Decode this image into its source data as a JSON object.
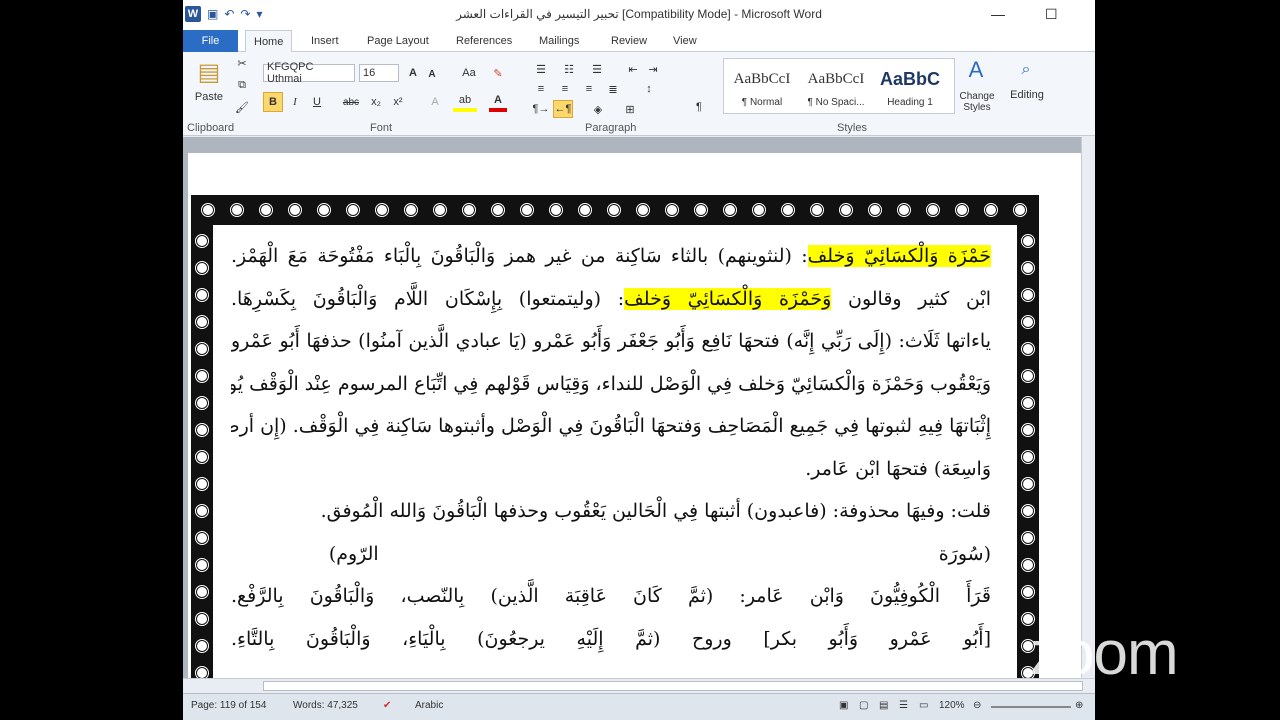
{
  "window": {
    "title": "تحبير التيسير في القراءات العشر [Compatibility Mode]  -  Microsoft Word",
    "qat_logo": "W"
  },
  "ribbon": {
    "tabs": [
      "File",
      "Home",
      "Insert",
      "Page Layout",
      "References",
      "Mailings",
      "Review",
      "View"
    ],
    "font_name": "KFGQPC Uthmai",
    "font_size": "16",
    "paste": "Paste",
    "groups": [
      "Clipboard",
      "Font",
      "Paragraph",
      "Styles"
    ],
    "style_samples": [
      {
        "sample": "AaBbCcI",
        "name": "¶ Normal"
      },
      {
        "sample": "AaBbCcI",
        "name": "¶ No Spaci..."
      },
      {
        "sample": "AaBbC",
        "name": "Heading 1"
      }
    ],
    "change_styles": "Change Styles",
    "editing": "Editing"
  },
  "document": {
    "lines": [
      "حَمْزَة وَالْكسَائِيّ وَخلف: (لنثوينهم) بالثاء سَاكِنة من غير همز وَالْبَاقُونَ بِالْبَاء مَفْتُوحَة مَعَ الْهَمْز.",
      "ابْن كثير وقالون وَحَمْزَة وَالْكسَائِيّ وَخلف: (وليتمتعوا) بِإِسْكَان اللَّام وَالْبَاقُونَ بِكَسْرِهَا.",
      "ياءاتها ثَلَاث: (إِلَى رَبِّي إِنَّه) فتحهَا نَافِع وَأَبُو جَعْفَر وَأَبُو عَمْرو (يَا عبادي الَّذين آمنُوا) حذفهَا أَبُو عَمْرو",
      "وَيَعْقُوب وَحَمْزَة وَالْكسَائِيّ وَخلف فِي الْوَصْل للنداء، وَقِيَاس قَوْلهم فِي اتِّبَاع المرسوم عِنْد الْوَقْف يُوجب",
      "إِثْبَاتهَا فِيهِ لثبوتها فِي جَمِيع الْمَصَاحِف وَفتحهَا الْبَاقُونَ فِي الْوَصْل وأثبتوها سَاكِنة فِي الْوَقْف. (إِن أرضي",
      "وَاسِعَة) فتحهَا ابْن عَامر.",
      "قلت: وفيهَا محذوفة: (فاعبدون) أثبتها فِي الْحَالين يَعْقُوب وحذفها الْبَاقُونَ وَالله الْمُوفق.",
      "(سُورَة                                                                                  الرّوم)",
      "قَرَأَ الْكُوفِيُّونَ وَابْن عَامر: (ثمَّ كَانَ عَاقِبَة الَّذين) بِالنّصب، وَالْبَاقُونَ بِالرَّفْع.",
      "[أَبُو عَمْرو وَأَبُو بكر] وروح (ثمَّ إِلَيْهِ يرجعُونَ) بِالْيَاءِ، وَالْبَاقُونَ بِالتَّاءِ."
    ],
    "highlight_1": "حَمْزَة وَالْكسَائِيّ وَخلف",
    "highlight_2": "وَحَمْزَة وَالْكسَائِيّ وَخلف"
  },
  "status": {
    "page": "Page: 119 of 154",
    "words": "Words: 47,325",
    "language": "Arabic",
    "zoom": "120%"
  },
  "overlay": {
    "zoom_logo": "zoom"
  },
  "colors": {
    "file_tab": "#2b6cc4",
    "highlight": "#ffff00"
  }
}
